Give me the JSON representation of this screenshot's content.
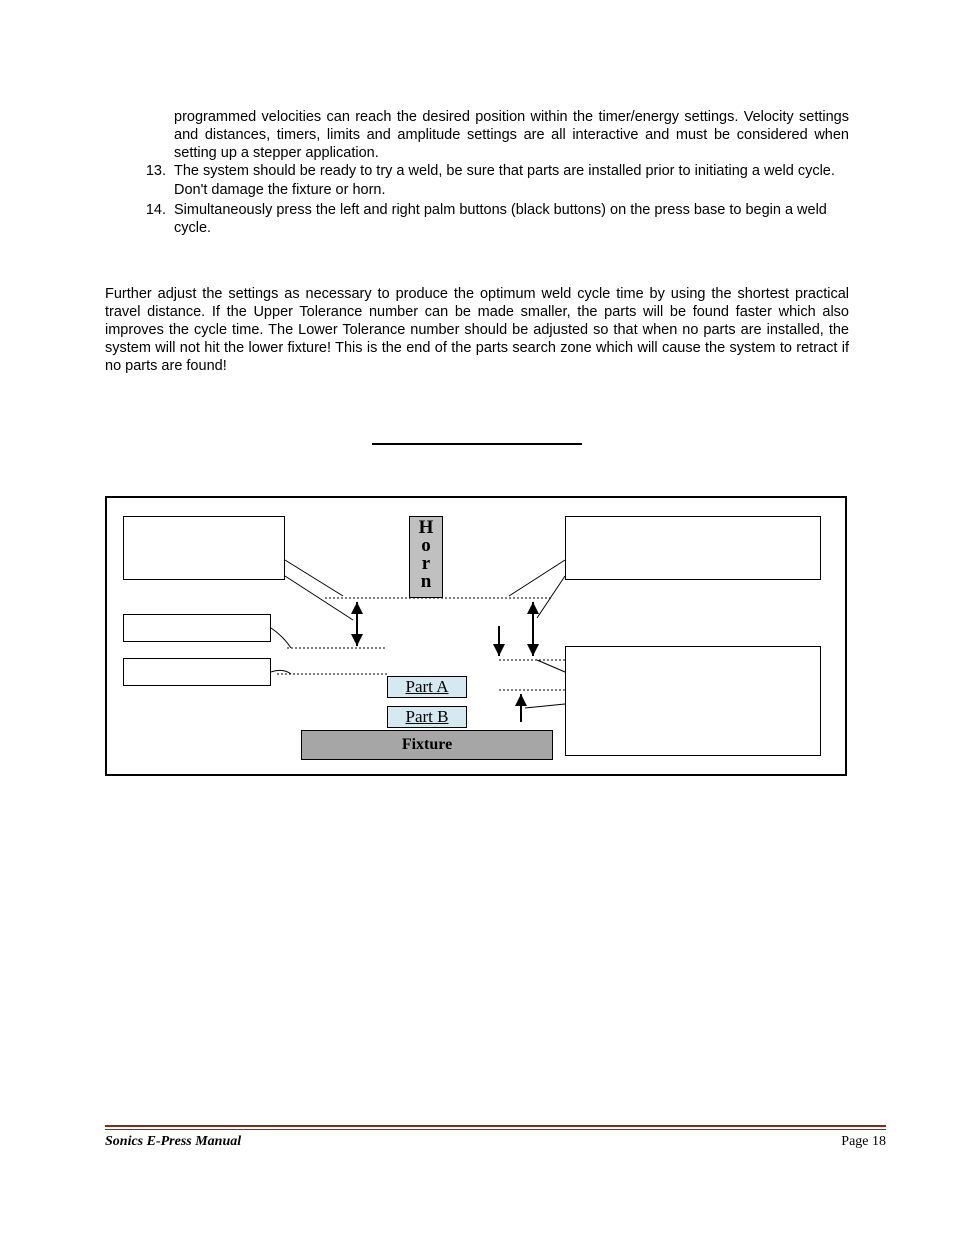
{
  "list": {
    "start": 13,
    "item_pre": "programmed velocities can reach the desired position within the timer/energy settings. Velocity settings and distances, timers, limits and amplitude settings are all interactive and must be considered when setting up a stepper application.",
    "item_13": "The system should be ready to try a weld, be sure that parts are installed prior to initiating a weld cycle.  Don't damage the fixture or horn.",
    "item_14": "Simultaneously press the left and right palm buttons (black buttons) on the press base to begin a weld cycle."
  },
  "paragraph": "Further adjust the settings as necessary to produce the optimum weld cycle time by using the shortest practical travel distance.  If the Upper Tolerance number can be made smaller, the parts will be found faster which also improves the cycle time.  The Lower Tolerance number should be adjusted so that when no parts are installed, the system will not hit the lower fixture!  This is the end of the parts search zone which will cause the system to retract if no parts are found!",
  "diagram": {
    "horn": "Horn",
    "part_a": "Part A",
    "part_b": "Part B",
    "fixture": "Fixture"
  },
  "footer": {
    "title": "Sonics E-Press Manual",
    "page_label": "Page 18"
  }
}
